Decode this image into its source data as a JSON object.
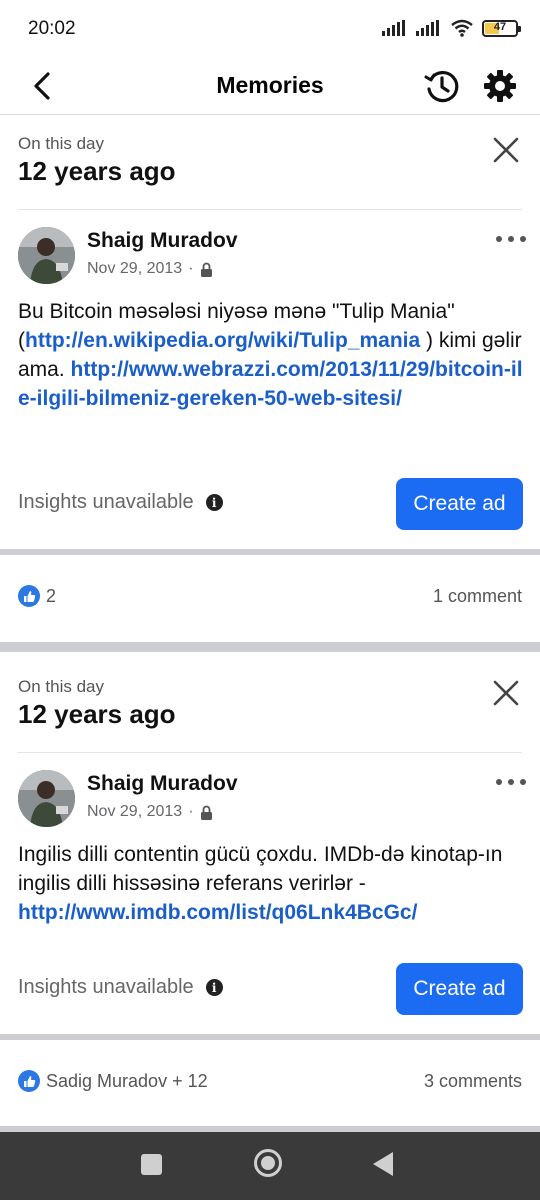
{
  "status_bar": {
    "time": "20:02",
    "battery": "47",
    "battery_level": 0.47
  },
  "header": {
    "title": "Memories"
  },
  "memories": [
    {
      "kicker": "On this day",
      "title": "12 years ago",
      "author": "Shaig Muradov",
      "date": "Nov 29, 2013",
      "date_sep": "·",
      "text_parts": {
        "t1": "Bu Bitcoin məsələsi niyəsə mənə \"Tulip Mania\" (",
        "link1": "http://en.wikipedia.org/wiki/Tulip_mania",
        "t2": " ) kimi gəlir ama. ",
        "link2": "http://www.webrazzi.com/2013/11/29/bitcoin-ile-ilgili-bilmeniz-gereken-50-web-sitesi/"
      },
      "insights": "Insights unavailable",
      "create_ad": "Create ad",
      "reactions": "2",
      "comments": "1 comment"
    },
    {
      "kicker": "On this day",
      "title": "12 years ago",
      "author": "Shaig Muradov",
      "date": "Nov 29, 2013",
      "date_sep": "·",
      "text_parts": {
        "t1": "Ingilis dilli contentin gücü çoxdu. IMDb-də kinotap-ın ingilis dilli hissəsinə referans verirlər - ",
        "link1": "http://www.imdb.com/list/q06Lnk4BcGc/"
      },
      "insights": "Insights unavailable",
      "create_ad": "Create ad",
      "reactions": "Sadig Muradov + 12",
      "comments": "3 comments"
    }
  ],
  "icons": {
    "back": "arrow-back-icon",
    "history": "history-icon",
    "settings": "gear-icon",
    "close": "close-icon",
    "more": "more-horizontal-icon",
    "lock": "lock-icon",
    "info": "info-icon",
    "like": "thumbs-up-icon"
  },
  "colors": {
    "accent": "#1b6cf2",
    "link": "#1a5fc9",
    "like": "#2b78e4"
  }
}
